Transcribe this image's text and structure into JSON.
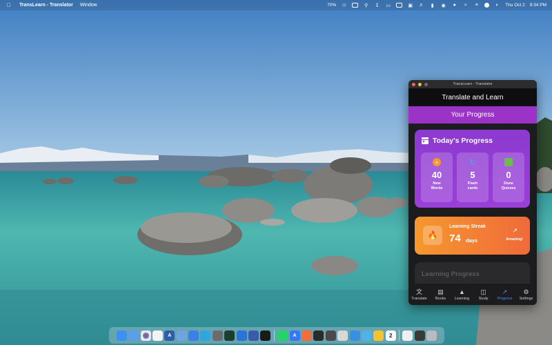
{
  "menubar": {
    "app_name": "TransLearn - Translator",
    "menu_window": "Window",
    "battery_text": "70%",
    "date": "Thu Oct 2",
    "time": "9:34 PM"
  },
  "window": {
    "title": "TransLearn - Translator",
    "header": "Translate and Learn",
    "section": "Your Progress"
  },
  "today": {
    "title": "Today's Progress",
    "stats": [
      {
        "value": "40",
        "label_line1": "New",
        "label_line2": "Words",
        "icon": "plus-circle-icon"
      },
      {
        "value": "5",
        "label_line1": "Flash",
        "label_line2": "cards",
        "icon": "cards-icon"
      },
      {
        "value": "0",
        "label_line1": "Done",
        "label_line2": "Quizzes",
        "icon": "quiz-icon"
      }
    ]
  },
  "streak": {
    "label": "Learning Streak",
    "value": "74",
    "unit": "days",
    "badge": "Amazing!"
  },
  "learning_progress": {
    "title": "Learning Progress"
  },
  "tabs": [
    {
      "label": "Translate",
      "icon": "translate-icon"
    },
    {
      "label": "Books",
      "icon": "book-icon"
    },
    {
      "label": "Learning",
      "icon": "graduation-cap-icon"
    },
    {
      "label": "Study",
      "icon": "study-cards-icon"
    },
    {
      "label": "Progress",
      "icon": "trend-icon",
      "active": true
    },
    {
      "label": "Settings",
      "icon": "gear-icon"
    }
  ],
  "dock": {
    "calendar_day": "2"
  },
  "colors": {
    "accent_purple": "#9b34c6",
    "streak_orange": "#f5982e",
    "active_tab": "#4a8cff"
  }
}
